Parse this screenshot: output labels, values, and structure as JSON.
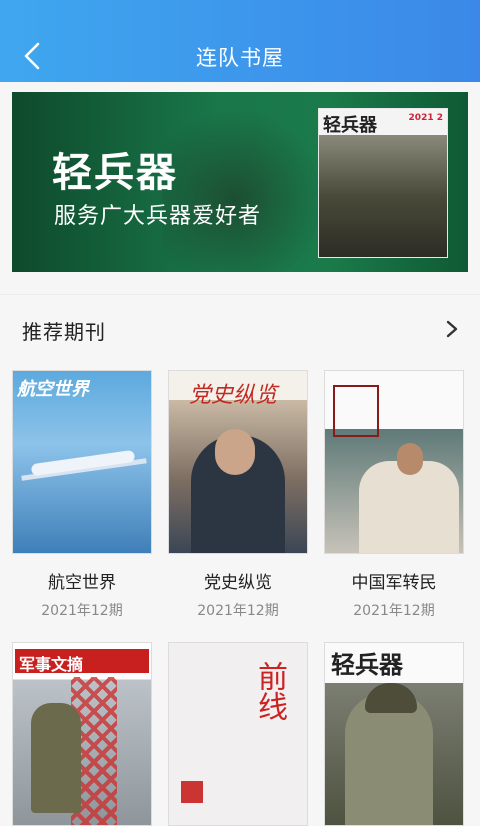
{
  "header": {
    "title": "连队书屋"
  },
  "banner": {
    "title": "轻兵器",
    "subtitle": "服务广大兵器爱好者",
    "magazine_title": "轻兵器",
    "magazine_issue": "2021 2"
  },
  "section": {
    "title": "推荐期刊"
  },
  "magazines": [
    {
      "name": "航空世界",
      "issue": "2021年12期",
      "cover_logo": "航空世界"
    },
    {
      "name": "党史纵览",
      "issue": "2021年12期",
      "cover_logo": "党史纵览"
    },
    {
      "name": "中国军转民",
      "issue": "2021年12期",
      "cover_logo": ""
    },
    {
      "name": "",
      "issue": "",
      "cover_logo": "军事文摘"
    },
    {
      "name": "",
      "issue": "",
      "cover_logo": "前线"
    },
    {
      "name": "",
      "issue": "",
      "cover_logo": "轻兵器"
    }
  ]
}
